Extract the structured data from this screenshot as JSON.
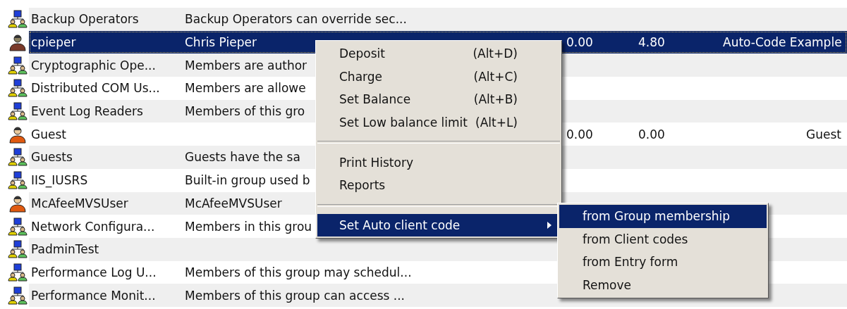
{
  "table": {
    "rows": [
      {
        "kind": "group",
        "name": "Backup Operators",
        "description": "Backup Operators can override sec...",
        "selected": false
      },
      {
        "kind": "user",
        "name": "cpieper",
        "description": "Chris Pieper",
        "column_4": "0.00",
        "column_5": "4.80",
        "column_6": "Auto-Code Example",
        "selected": true
      },
      {
        "kind": "group",
        "name": "Cryptographic Ope...",
        "description": "Members are author",
        "selected": false
      },
      {
        "kind": "group",
        "name": "Distributed COM Us...",
        "description": "Members are allowe",
        "selected": false
      },
      {
        "kind": "group",
        "name": "Event Log Readers",
        "description": "Members of this gro",
        "selected": false
      },
      {
        "kind": "user",
        "name": "Guest",
        "column_4": "0.00",
        "column_5": "0.00",
        "column_7": "Guest",
        "selected": false
      },
      {
        "kind": "group",
        "name": "Guests",
        "description": "Guests have the sa",
        "selected": false
      },
      {
        "kind": "group",
        "name": "IIS_IUSRS",
        "description": "Built-in group used b",
        "selected": false
      },
      {
        "kind": "user",
        "name": "McAfeeMVSUser",
        "description": "McAfeeMVSUser",
        "selected": false
      },
      {
        "kind": "group",
        "name": "Network Configura...",
        "description": "Members in this grou",
        "selected": false
      },
      {
        "kind": "group",
        "name": "PadminTest",
        "selected": false
      },
      {
        "kind": "group",
        "name": "Performance Log U...",
        "description": "Members of this group may schedul...",
        "selected": false
      },
      {
        "kind": "group",
        "name": "Performance Monit...",
        "description": "Members of this group can access ...",
        "selected": false
      }
    ]
  },
  "context_menu": {
    "items": [
      {
        "kind": "item",
        "label": "Deposit",
        "shortcut": "(Alt+D)",
        "selected": false
      },
      {
        "kind": "item",
        "label": "Charge",
        "shortcut": "(Alt+C)",
        "selected": false
      },
      {
        "kind": "item",
        "label": "Set Balance",
        "shortcut": "(Alt+B)",
        "selected": false
      },
      {
        "kind": "item",
        "label": "Set Low balance limit",
        "shortcut": "(Alt+L)",
        "selected": false
      },
      {
        "kind": "separator"
      },
      {
        "kind": "item",
        "label": "Print History",
        "selected": false
      },
      {
        "kind": "item",
        "label": "Reports",
        "selected": false
      },
      {
        "kind": "separator"
      },
      {
        "kind": "submenu",
        "label": "Set Auto client code",
        "selected": true
      }
    ]
  },
  "submenu": {
    "items": [
      {
        "label": "from Group membership",
        "selected": true
      },
      {
        "label": "from Client codes",
        "selected": false
      },
      {
        "label": "from Entry form",
        "selected": false
      },
      {
        "label": "Remove",
        "selected": false
      }
    ]
  }
}
